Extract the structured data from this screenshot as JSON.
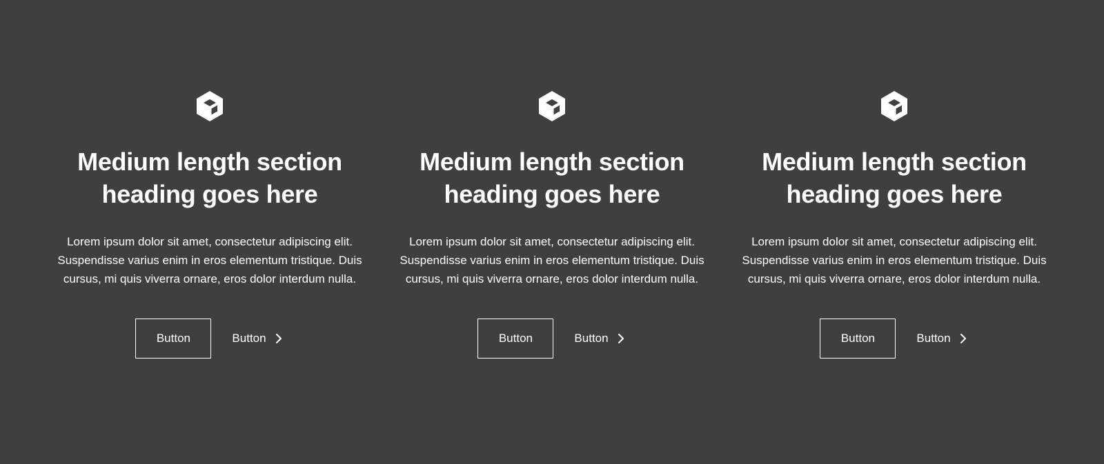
{
  "theme": {
    "background": "#3f3f3f",
    "text": "#ffffff"
  },
  "features": [
    {
      "icon": "cube-icon",
      "heading": "Medium length section heading goes here",
      "body": "Lorem ipsum dolor sit amet, consectetur adipiscing elit. Suspendisse varius enim in eros elementum tristique. Duis cursus, mi quis viverra ornare, eros dolor interdum nulla.",
      "primary_button": "Button",
      "secondary_button": "Button",
      "secondary_icon": "chevron-right-icon"
    },
    {
      "icon": "cube-icon",
      "heading": "Medium length section heading goes here",
      "body": "Lorem ipsum dolor sit amet, consectetur adipiscing elit. Suspendisse varius enim in eros elementum tristique. Duis cursus, mi quis viverra ornare, eros dolor interdum nulla.",
      "primary_button": "Button",
      "secondary_button": "Button",
      "secondary_icon": "chevron-right-icon"
    },
    {
      "icon": "cube-icon",
      "heading": "Medium length section heading goes here",
      "body": "Lorem ipsum dolor sit amet, consectetur adipiscing elit. Suspendisse varius enim in eros elementum tristique. Duis cursus, mi quis viverra ornare, eros dolor interdum nulla.",
      "primary_button": "Button",
      "secondary_button": "Button",
      "secondary_icon": "chevron-right-icon"
    }
  ]
}
